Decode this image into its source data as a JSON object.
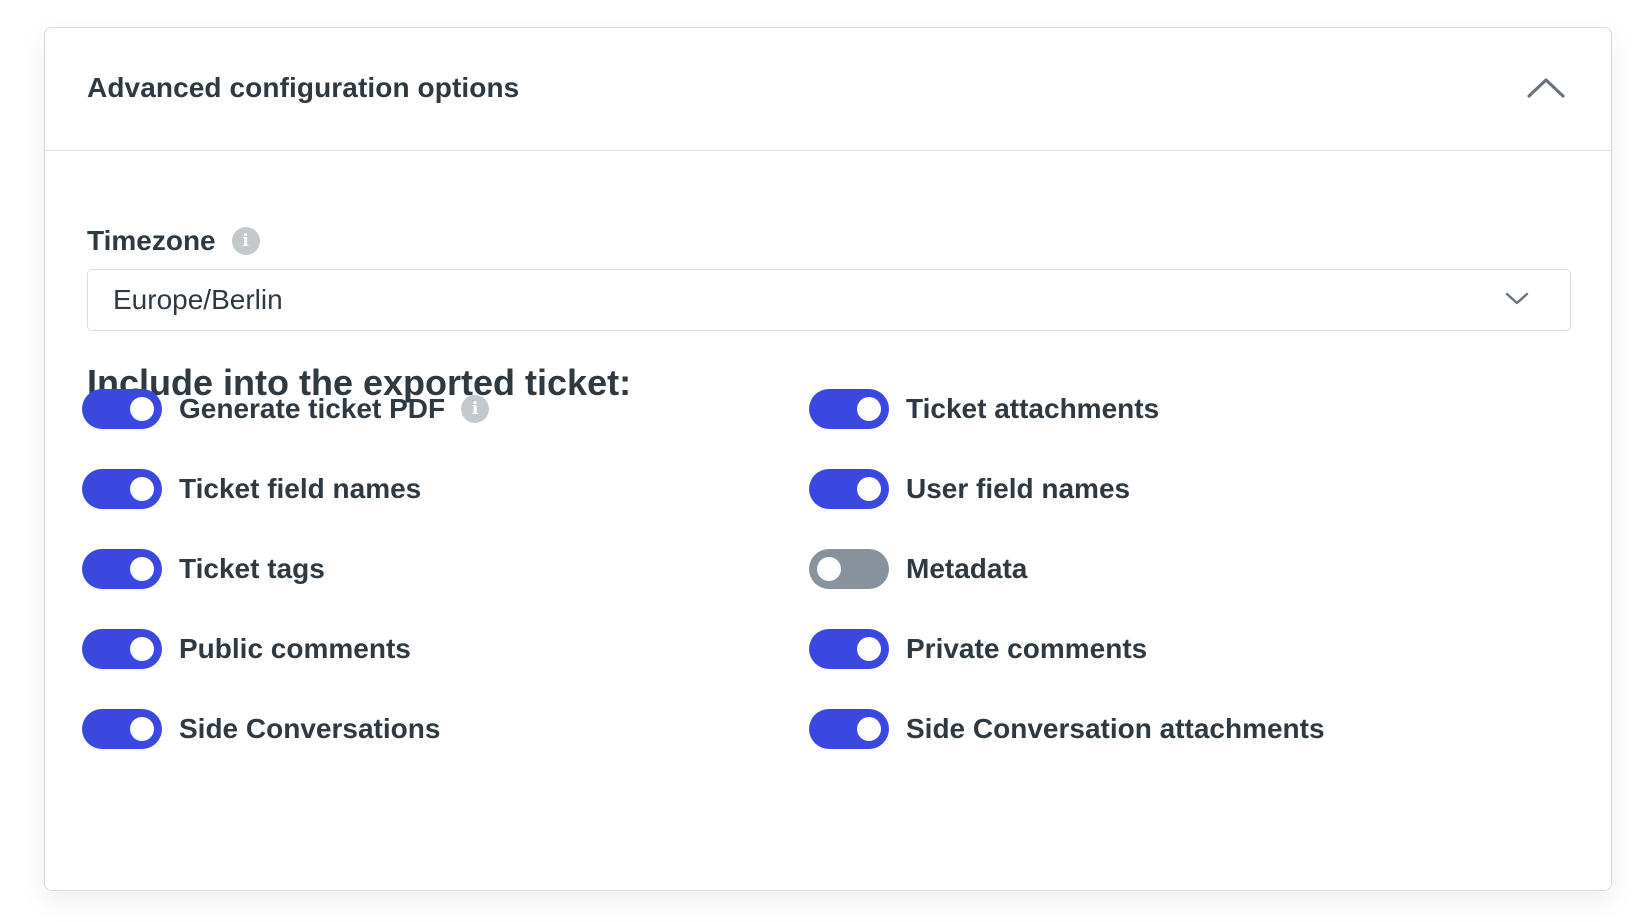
{
  "panel": {
    "title": "Advanced configuration options",
    "expanded": true,
    "collapse_icon": "chevron-up-icon"
  },
  "timezone": {
    "label": "Timezone",
    "info_icon": "info-icon",
    "value": "Europe/Berlin",
    "dropdown_icon": "chevron-down-icon"
  },
  "include": {
    "heading": "Include into the exported ticket:",
    "options": [
      {
        "label": "Generate ticket PDF",
        "enabled": true,
        "has_info": true
      },
      {
        "label": "Ticket attachments",
        "enabled": true,
        "has_info": false
      },
      {
        "label": "Ticket field names",
        "enabled": true,
        "has_info": false
      },
      {
        "label": "User field names",
        "enabled": true,
        "has_info": false
      },
      {
        "label": "Ticket tags",
        "enabled": true,
        "has_info": false
      },
      {
        "label": "Metadata",
        "enabled": false,
        "has_info": false
      },
      {
        "label": "Public comments",
        "enabled": true,
        "has_info": false
      },
      {
        "label": "Private comments",
        "enabled": true,
        "has_info": false
      },
      {
        "label": "Side Conversations",
        "enabled": true,
        "has_info": false
      },
      {
        "label": "Side Conversation attachments",
        "enabled": true,
        "has_info": false
      }
    ]
  },
  "colors": {
    "toggle_on": "#3b48e0",
    "toggle_off": "#87929d",
    "text": "#2f3941",
    "border": "#d8dcde",
    "info_icon": "#c2c8cc"
  }
}
